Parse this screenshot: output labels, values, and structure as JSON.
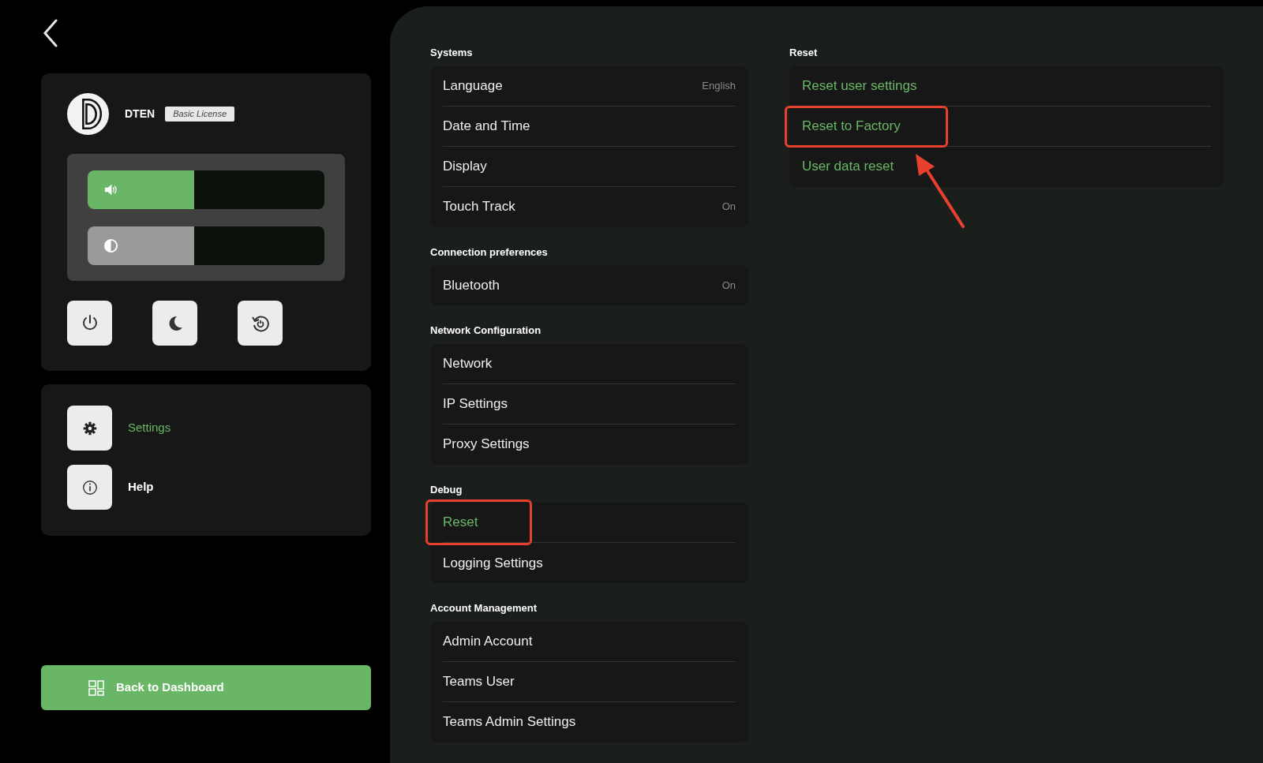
{
  "device": {
    "name": "DTEN",
    "license": "Basic License"
  },
  "sliders": [
    {
      "kind": "volume",
      "level": 0.45
    },
    {
      "kind": "brightness",
      "level": 0.45
    }
  ],
  "quick_actions": [
    {
      "kind": "power"
    },
    {
      "kind": "sleep"
    },
    {
      "kind": "restart"
    }
  ],
  "nav": [
    {
      "label": "Settings",
      "kind": "settings",
      "selected": true
    },
    {
      "label": "Help",
      "kind": "help",
      "selected": false
    }
  ],
  "dashboard_button": "Back to Dashboard",
  "sections": [
    {
      "title": "Systems",
      "items": [
        {
          "label": "Language",
          "value": "English",
          "selected": false,
          "highlighted": false
        },
        {
          "label": "Date and Time",
          "selected": false,
          "highlighted": false
        },
        {
          "label": "Display",
          "selected": false,
          "highlighted": false
        },
        {
          "label": "Touch Track",
          "value": "On",
          "selected": false,
          "highlighted": false
        }
      ]
    },
    {
      "title": "Connection preferences",
      "items": [
        {
          "label": "Bluetooth",
          "value": "On",
          "selected": false,
          "highlighted": false
        }
      ]
    },
    {
      "title": "Network Configuration",
      "items": [
        {
          "label": "Network",
          "selected": false,
          "highlighted": false
        },
        {
          "label": "IP Settings",
          "selected": false,
          "highlighted": false
        },
        {
          "label": "Proxy Settings",
          "selected": false,
          "highlighted": false
        }
      ]
    },
    {
      "title": "Debug",
      "items": [
        {
          "label": "Reset",
          "selected": true,
          "highlighted": true
        },
        {
          "label": "Logging Settings",
          "selected": false,
          "highlighted": false
        }
      ]
    },
    {
      "title": "Account Management",
      "items": [
        {
          "label": "Admin Account",
          "selected": false,
          "highlighted": false
        },
        {
          "label": "Teams User",
          "selected": false,
          "highlighted": false
        },
        {
          "label": "Teams Admin Settings",
          "selected": false,
          "highlighted": false
        }
      ]
    }
  ],
  "detail": {
    "title": "Reset",
    "items": [
      {
        "label": "Reset user settings",
        "highlighted": false
      },
      {
        "label": "Reset to Factory",
        "highlighted": true
      },
      {
        "label": "User data reset",
        "highlighted": false
      }
    ]
  }
}
